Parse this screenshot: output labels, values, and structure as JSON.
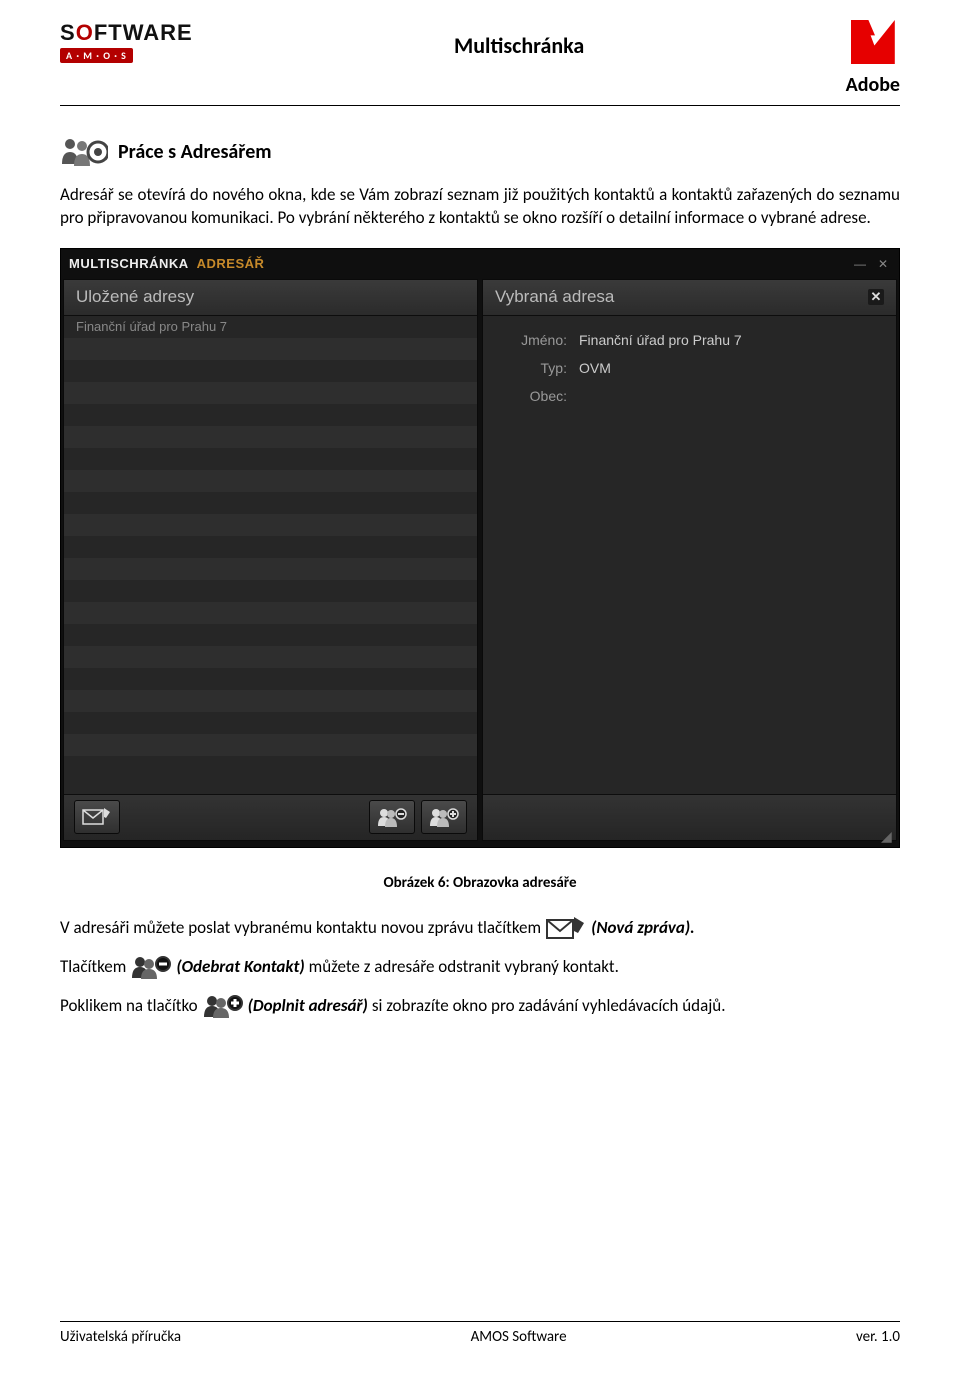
{
  "header": {
    "left_logo_text": "SOFTWARE",
    "left_logo_sub": "A · M · O · S",
    "page_title": "Multischránka",
    "right_logo_text": "Adobe"
  },
  "section": {
    "heading": "Práce s Adresářem",
    "paragraph": "Adresář se otevírá do nového okna, kde se Vám zobrazí seznam již použitých kontaktů a kontaktů zařazených do seznamu pro připravovanou komunikaci. Po vybrání některého z kontaktů se okno rozšíří o detailní informace o vybrané adrese."
  },
  "app": {
    "titlebar_app": "MULTISCHRÁNKA",
    "titlebar_section": "ADRESÁŘ",
    "left_panel": {
      "title": "Uložené adresy",
      "items": [
        "Finanční úřad pro Prahu 7"
      ]
    },
    "right_panel": {
      "title": "Vybraná adresa",
      "fields": {
        "jmeno_label": "Jméno:",
        "jmeno_value": "Finanční úřad pro Prahu 7",
        "typ_label": "Typ:",
        "typ_value": "OVM",
        "obec_label": "Obec:",
        "obec_value": ""
      }
    },
    "toolbar_icons": {
      "new_message": "new-message-icon",
      "remove_contact": "remove-contact-icon",
      "add_contact": "add-contact-icon"
    }
  },
  "caption": "Obrázek 6: Obrazovka adresáře",
  "lines": {
    "l1_a": "V adresáři můžete poslat vybranému kontaktu novou zprávu tlačítkem",
    "l1_b": "(Nová zpráva).",
    "l2_a": "Tlačítkem",
    "l2_b": "(Odebrat  Kontakt)",
    "l2_c": "můžete z adresáře odstranit vybraný kontakt.",
    "l3_a": "Poklikem na tlačítko",
    "l3_b": "(Doplnit adresář)",
    "l3_c": "si zobrazíte okno pro zadávání vyhledávacích údajů."
  },
  "footer": {
    "left": "Uživatelská příručka",
    "center": "AMOS Software",
    "right": "ver. 1.0"
  }
}
